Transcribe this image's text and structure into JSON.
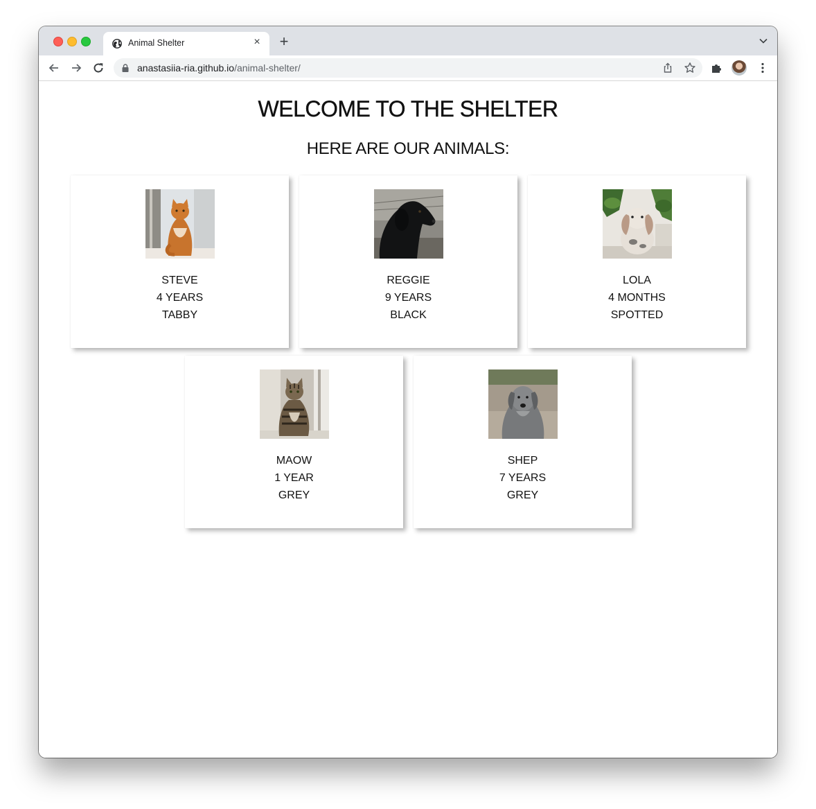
{
  "browser": {
    "tab": {
      "title": "Animal Shelter",
      "close_label": "×"
    },
    "new_tab_label": "+",
    "address_bar": {
      "domain": "anastasiia-ria.github.io",
      "path": "/animal-shelter/"
    }
  },
  "page": {
    "title": "WELCOME TO THE SHELTER",
    "subtitle": "HERE ARE OUR ANIMALS:"
  },
  "animals": [
    {
      "name": "STEVE",
      "age": "4 YEARS",
      "color": "TABBY",
      "photo_icon": "orange-tabby-cat-photo"
    },
    {
      "name": "REGGIE",
      "age": "9 YEARS",
      "color": "BLACK",
      "photo_icon": "black-dog-photo"
    },
    {
      "name": "LOLA",
      "age": "4 MONTHS",
      "color": "SPOTTED",
      "photo_icon": "lop-bunny-photo"
    },
    {
      "name": "MAOW",
      "age": "1 YEAR",
      "color": "GREY",
      "photo_icon": "tabby-cat-photo"
    },
    {
      "name": "SHEP",
      "age": "7 YEARS",
      "color": "GREY",
      "photo_icon": "grey-dog-photo"
    }
  ],
  "colors": {
    "tabbar_bg": "#dee1e6",
    "omnibox_bg": "#f1f3f4",
    "text": "#111111"
  }
}
